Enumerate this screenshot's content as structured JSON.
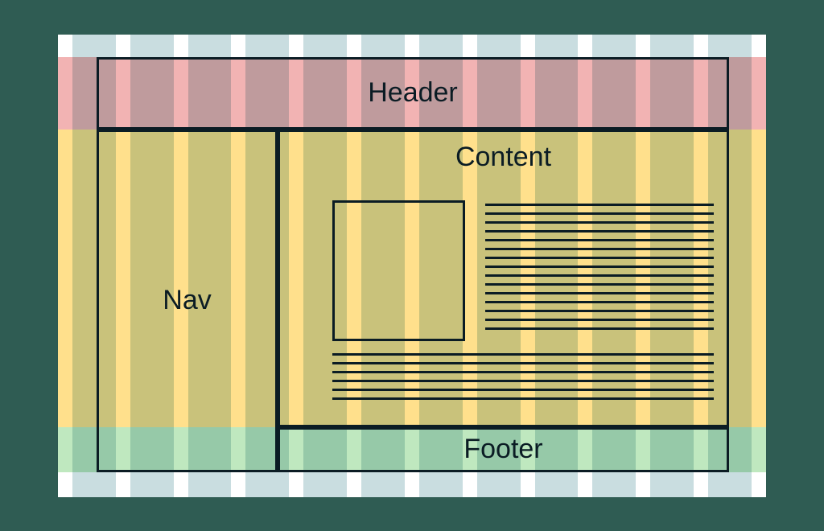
{
  "layout": {
    "header": {
      "label": "Header"
    },
    "nav": {
      "label": "Nav"
    },
    "content": {
      "label": "Content"
    },
    "footer": {
      "label": "Footer"
    }
  },
  "grid": {
    "columns": 12,
    "row_bands": [
      "header",
      "middle",
      "footer"
    ]
  },
  "colors": {
    "column_stripe": "#c9dde0",
    "header_band": "#f2b3b3",
    "middle_band": "#ffe08c",
    "footer_band": "#bfe8bf",
    "outline": "#0b1c24",
    "page_bg": "#2f5c53"
  },
  "content_placeholder": {
    "image_box": true,
    "text_lines_beside_image": 15,
    "text_lines_below_image": 6
  }
}
